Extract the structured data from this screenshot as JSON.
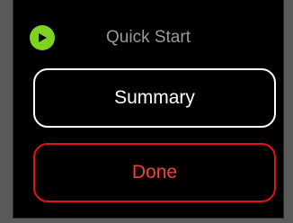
{
  "header": {
    "title": "Quick Start",
    "app_icon": "play-icon",
    "app_icon_color": "#7ed321"
  },
  "buttons": {
    "summary_label": "Summary",
    "done_label": "Done"
  },
  "colors": {
    "background": "#000000",
    "title": "#9a9a9a",
    "summary_border": "#ffffff",
    "done_border": "#e4101a",
    "done_text": "#ff3a3a"
  }
}
